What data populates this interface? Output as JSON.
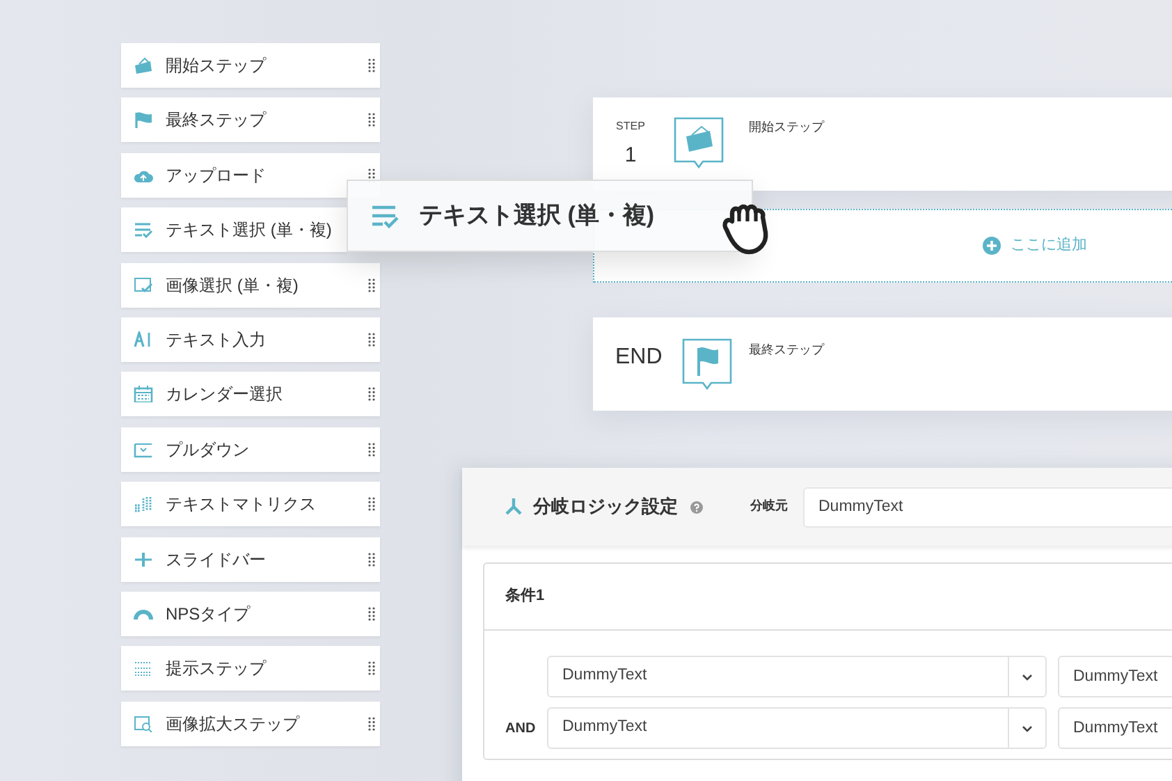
{
  "palette": {
    "items": [
      {
        "label": "開始ステップ",
        "dragging": false
      },
      {
        "label": "最終ステップ",
        "dragging": false
      },
      {
        "label": "アップロード",
        "dragging": false
      },
      {
        "label": "テキスト選択 (単・複)",
        "dragging": true
      },
      {
        "label": "画像選択 (単・複)",
        "dragging": false
      },
      {
        "label": "テキスト入力",
        "dragging": false
      },
      {
        "label": "カレンダー選択",
        "dragging": false
      },
      {
        "label": "プルダウン",
        "dragging": false
      },
      {
        "label": "テキストマトリクス",
        "dragging": false
      },
      {
        "label": "スライドバー",
        "dragging": false
      },
      {
        "label": "NPSタイプ",
        "dragging": false
      },
      {
        "label": "提示ステップ",
        "dragging": false
      },
      {
        "label": "画像拡大ステップ",
        "dragging": false
      }
    ]
  },
  "dragged_item": {
    "label": "テキスト選択 (単・複)"
  },
  "flow": [
    {
      "kind": "step",
      "step_label": "STEP",
      "number": "1",
      "title": "開始ステップ"
    },
    {
      "kind": "dropzone",
      "label": "ここに追加"
    },
    {
      "kind": "end",
      "label": "END",
      "title": "最終ステップ"
    }
  ],
  "branch_logic": {
    "title": "分岐ロジック設定",
    "source_label": "分岐元",
    "source_value": "DummyText",
    "condition": {
      "title": "条件1",
      "rows": [
        {
          "field": "DummyText",
          "value": "DummyText"
        },
        {
          "operator": "AND",
          "field": "DummyText",
          "value": "DummyText"
        }
      ]
    }
  }
}
